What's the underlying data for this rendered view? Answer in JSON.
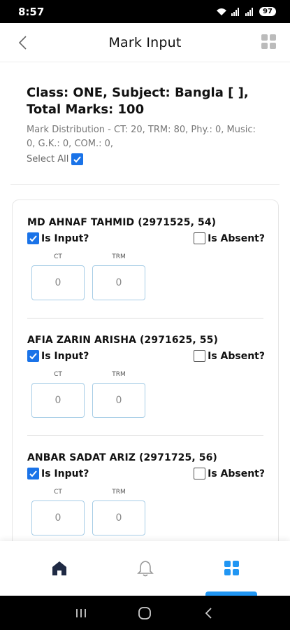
{
  "status_bar": {
    "time": "8:57",
    "battery": "97"
  },
  "header": {
    "title": "Mark Input"
  },
  "info": {
    "title": "Class: ONE,  Subject: Bangla [ ], Total Marks: 100",
    "distribution": "Mark Distribution - CT: 20, TRM: 80, Phy.: 0, Music: 0, G.K.: 0, COM.: 0,",
    "select_all_label": "Select All",
    "select_all_checked": true
  },
  "labels": {
    "is_input": "Is Input?",
    "is_absent": "Is Absent?",
    "ct": "CT",
    "trm": "TRM"
  },
  "students": [
    {
      "name": "MD AHNAF TAHMID (2971525, 54)",
      "is_input": true,
      "is_absent": false,
      "ct": "0",
      "trm": "0"
    },
    {
      "name": "AFIA ZARIN ARISHA (2971625, 55)",
      "is_input": true,
      "is_absent": false,
      "ct": "0",
      "trm": "0"
    },
    {
      "name": "ANBAR SADAT ARIZ (2971725, 56)",
      "is_input": true,
      "is_absent": false,
      "ct": "0",
      "trm": "0"
    }
  ],
  "bottom_nav": {
    "items": [
      "home-icon",
      "bell-icon",
      "dashboard-icon"
    ],
    "active": "dashboard-icon"
  },
  "colors": {
    "accent": "#1a73e8",
    "nav_active": "#2196f3",
    "input_border": "#a7cde6"
  }
}
